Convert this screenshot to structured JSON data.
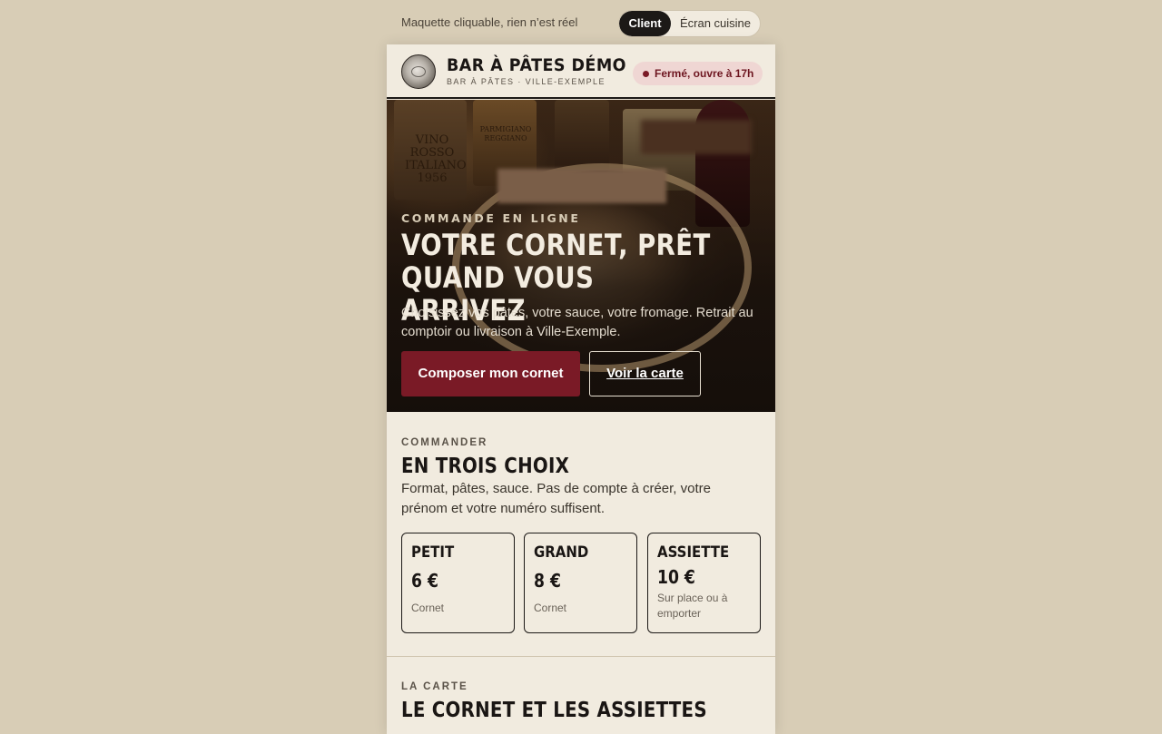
{
  "topbar": {
    "note": "Maquette cliquable, rien n’est réel",
    "toggle": {
      "client": "Client",
      "kitchen": "Écran cuisine"
    }
  },
  "header": {
    "brand_name": "BAR À PÂTES DÉMO",
    "brand_sub": "BAR À PÂTES · VILLE-EXEMPLE",
    "status": "Fermé, ouvre à 17h"
  },
  "hero": {
    "image_labels": {
      "bottle_1": "VINO ROSSO ITALIANO 1956",
      "bottle_2": "PARMIGIANO REGGIANO"
    },
    "kicker": "COMMANDE EN LIGNE",
    "title": "VOTRE CORNET, PRÊT QUAND VOUS ARRIVEZ",
    "text": "Choisissez vos pâtes, votre sauce, votre fromage. Retrait au comptoir ou livraison à Ville-Exemple.",
    "primary_button": "Composer mon cornet",
    "secondary_button": "Voir la carte"
  },
  "order": {
    "kicker": "COMMANDER",
    "title": "EN TROIS CHOIX",
    "text": "Format, pâtes, sauce. Pas de compte à créer, votre prénom et votre numéro suffisent.",
    "cards": [
      {
        "name": "PETIT",
        "price": "6 €",
        "note": "Cornet"
      },
      {
        "name": "GRAND",
        "price": "8 €",
        "note": "Cornet"
      },
      {
        "name": "ASSIETTE",
        "price": "10 €",
        "note": "Sur place ou à emporter"
      }
    ]
  },
  "menu": {
    "kicker": "LA CARTE",
    "title": "LE CORNET ET LES ASSIETTES"
  },
  "colors": {
    "page_bg": "#d8cdb6",
    "panel_bg": "#f1ebdf",
    "accent": "#7a1a26",
    "status_bg": "#efd6d3",
    "dark": "#1c1917"
  }
}
